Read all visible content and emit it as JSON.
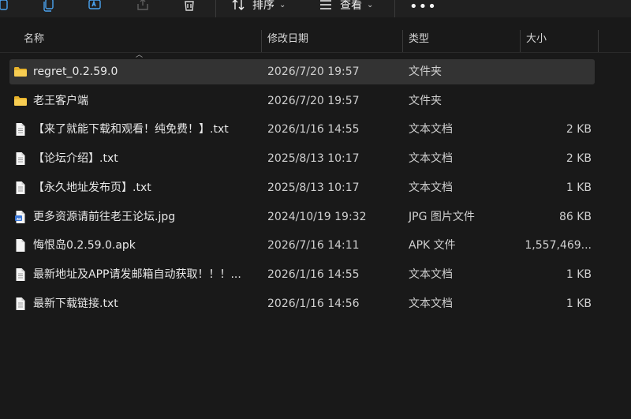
{
  "toolbar": {
    "sort_label": "排序",
    "view_label": "查看",
    "more_label": "•••"
  },
  "columns": {
    "name": "名称",
    "date": "修改日期",
    "type": "类型",
    "size": "大小"
  },
  "files": [
    {
      "name": "regret_0.2.59.0",
      "date": "2026/7/20 19:57",
      "type": "文件夹",
      "size": "",
      "icon": "folder-icon"
    },
    {
      "name": "老王客户端",
      "date": "2026/7/20 19:57",
      "type": "文件夹",
      "size": "",
      "icon": "folder-icon"
    },
    {
      "name": "【来了就能下载和观看！纯免费！】.txt",
      "date": "2026/1/16 14:55",
      "type": "文本文档",
      "size": "2 KB",
      "icon": "text-file-icon"
    },
    {
      "name": "【论坛介绍】.txt",
      "date": "2025/8/13 10:17",
      "type": "文本文档",
      "size": "2 KB",
      "icon": "text-file-icon"
    },
    {
      "name": "【永久地址发布页】.txt",
      "date": "2025/8/13 10:17",
      "type": "文本文档",
      "size": "1 KB",
      "icon": "text-file-icon"
    },
    {
      "name": "更多资源请前往老王论坛.jpg",
      "date": "2024/10/19 19:32",
      "type": "JPG 图片文件",
      "size": "86 KB",
      "icon": "image-file-icon"
    },
    {
      "name": "悔恨岛0.2.59.0.apk",
      "date": "2026/7/16 14:11",
      "type": "APK 文件",
      "size": "1,557,469...",
      "icon": "file-icon"
    },
    {
      "name": "最新地址及APP请发邮箱自动获取！！！...",
      "date": "2026/1/16 14:55",
      "type": "文本文档",
      "size": "1 KB",
      "icon": "text-file-icon"
    },
    {
      "name": "最新下载链接.txt",
      "date": "2026/1/16 14:56",
      "type": "文本文档",
      "size": "1 KB",
      "icon": "text-file-icon"
    }
  ]
}
